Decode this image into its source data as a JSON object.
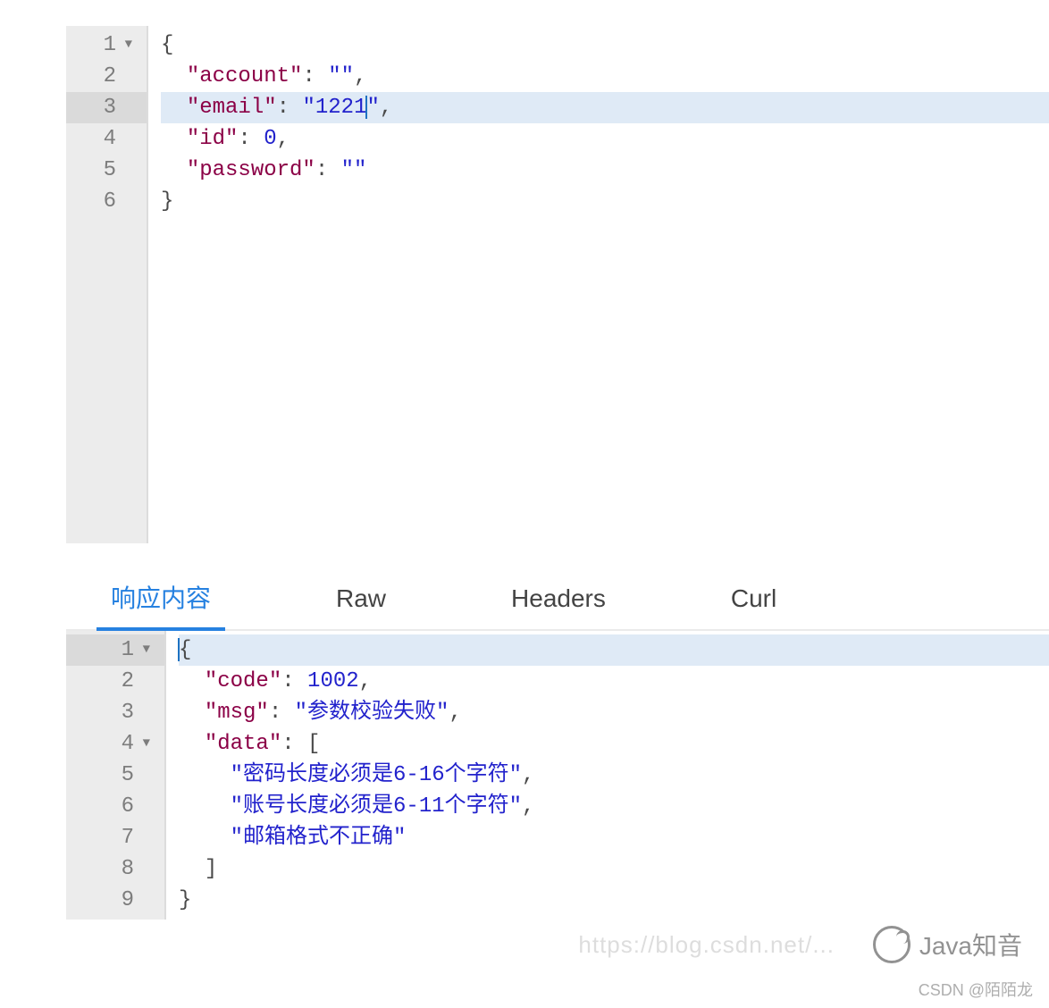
{
  "request_editor": {
    "lines": [
      {
        "num": "1",
        "foldable": true
      },
      {
        "num": "2"
      },
      {
        "num": "3",
        "active": true
      },
      {
        "num": "4"
      },
      {
        "num": "5"
      },
      {
        "num": "6"
      }
    ],
    "json": {
      "account_key": "\"account\"",
      "account_val": "\"\"",
      "email_key": "\"email\"",
      "email_val_open": "\"1221",
      "email_val_close": "\"",
      "id_key": "\"id\"",
      "id_val": "0",
      "password_key": "\"password\"",
      "password_val": "\"\""
    }
  },
  "tabs": {
    "response": "响应内容",
    "raw": "Raw",
    "headers": "Headers",
    "curl": "Curl"
  },
  "response_editor": {
    "lines": [
      {
        "num": "1",
        "foldable": true,
        "active": true
      },
      {
        "num": "2"
      },
      {
        "num": "3"
      },
      {
        "num": "4",
        "foldable": true
      },
      {
        "num": "5"
      },
      {
        "num": "6"
      },
      {
        "num": "7"
      },
      {
        "num": "8"
      },
      {
        "num": "9"
      }
    ],
    "json": {
      "code_key": "\"code\"",
      "code_val": "1002",
      "msg_key": "\"msg\"",
      "msg_val": "\"参数校验失败\"",
      "data_key": "\"data\"",
      "data_item1": "\"密码长度必须是6-16个字符\"",
      "data_item2": "\"账号长度必须是6-11个字符\"",
      "data_item3": "\"邮箱格式不正确\""
    }
  },
  "watermark": {
    "logo_text": "Java知音",
    "url": "https://blog.csdn.net/...",
    "csdn": "CSDN @陌陌龙"
  }
}
